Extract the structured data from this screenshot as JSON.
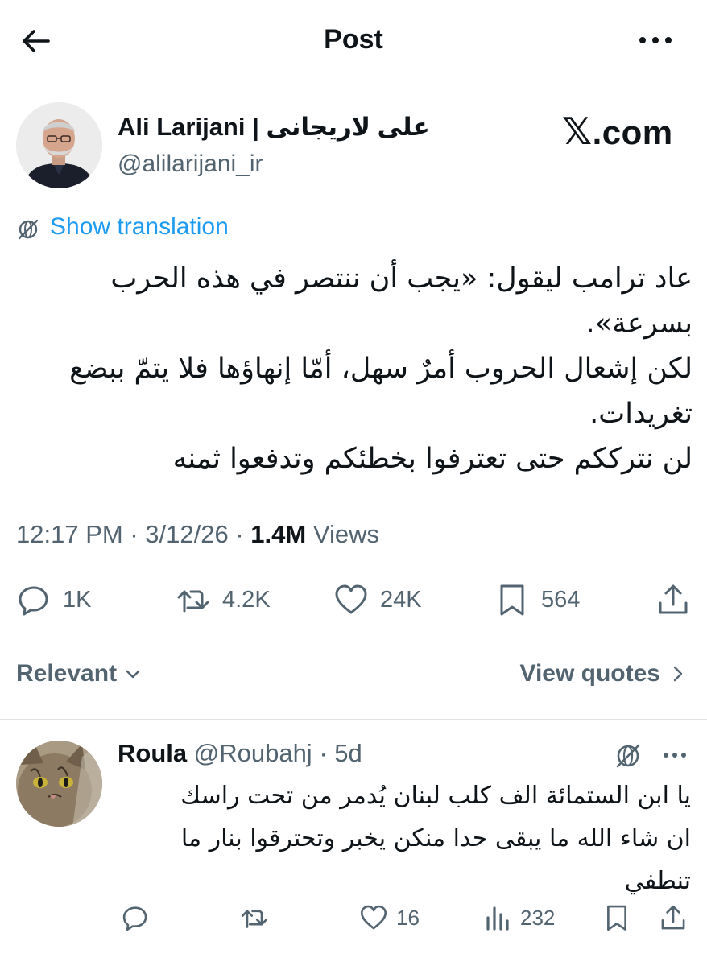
{
  "header": {
    "title": "Post"
  },
  "author": {
    "name": "Ali Larijani | علی لاریجانی",
    "handle": "@alilarijani_ir"
  },
  "watermark": {
    "glyph": "𝕏",
    "text": ".com"
  },
  "translation": {
    "label": "Show translation"
  },
  "post": {
    "lines": [
      "عاد ترامب ليقول: «يجب أن ننتصر في هذه الحرب",
      "بسرعة».",
      "لكن إشعال الحروب أمرٌ سهل، أمّا إنهاؤها فلا يتمّ ببضع",
      "تغريدات.",
      "لن نترككم حتى تعترفوا بخطئكم وتدفعوا ثمنه"
    ],
    "time": "12:17 PM",
    "date": "3/12/26",
    "separator": "·",
    "views_count": "1.4M",
    "views_label": "Views"
  },
  "actions": {
    "replies": "1K",
    "reposts": "4.2K",
    "likes": "24K",
    "bookmarks": "564"
  },
  "sort": {
    "label": "Relevant",
    "view_quotes": "View quotes"
  },
  "reply": {
    "name": "Roula",
    "handle": "@Roubahj",
    "time": "5d",
    "lines": [
      "يا ابن الستمائة الف كلب لبنان يُدمر من تحت راسك",
      "ان شاء الله ما يبقى حدا منكن يخبر وتحترقوا  بنار ما",
      "تنطفي"
    ],
    "likes": "16",
    "views": "232"
  },
  "colors": {
    "accent": "#1d9bf0",
    "text": "#0f1419",
    "muted": "#536471",
    "divider": "#dfe3e6"
  }
}
